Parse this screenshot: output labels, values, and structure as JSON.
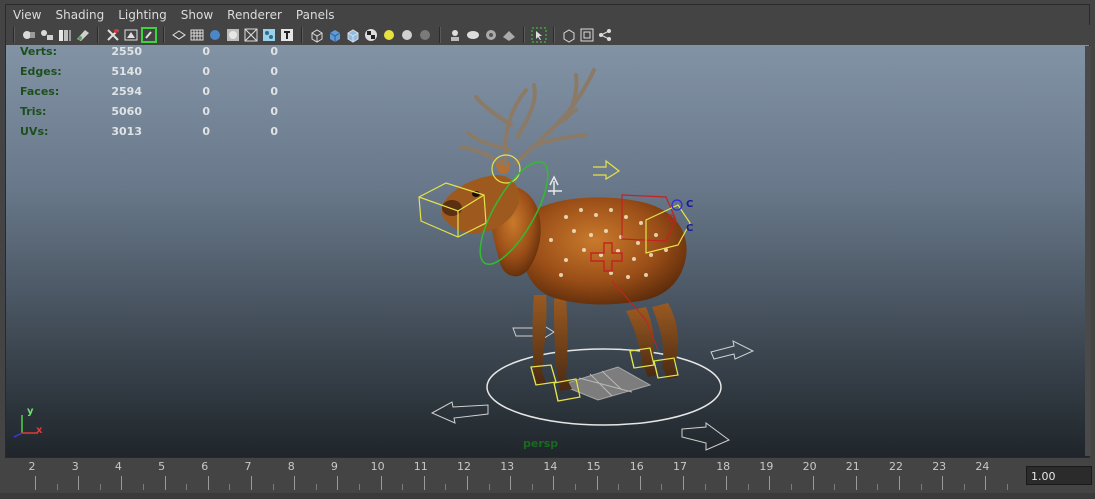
{
  "menu": [
    "View",
    "Shading",
    "Lighting",
    "Show",
    "Renderer",
    "Panels"
  ],
  "toolbar_icons": [
    "select-camera-icon",
    "camera-attributes-icon",
    "bookmark-icon",
    "image-plane-icon",
    "grid-toggle-icon",
    "resolution-gate-icon",
    "film-gate-icon",
    "wireframe-icon",
    "smooth-shade-icon",
    "shade-all-icon",
    "bounding-box-icon",
    "xray-icon",
    "texture-icon",
    "default-material-icon",
    "smooth-shade-selected-icon",
    "wireframe-on-shaded-icon",
    "checker-texture-icon",
    "lights-icon",
    "shadows-icon",
    "ambient-occlusion-icon",
    "isolate-select-icon",
    "xray-joints-icon",
    "xray-active-icon",
    "backface-icon",
    "select-tool-icon",
    "paint-select-icon",
    "frame-all-icon",
    "frame-selected-icon",
    "hierarchy-icon"
  ],
  "hud": [
    {
      "label": "Verts:",
      "values": [
        "2550",
        "0",
        "0"
      ]
    },
    {
      "label": "Edges:",
      "values": [
        "5140",
        "0",
        "0"
      ]
    },
    {
      "label": "Faces:",
      "values": [
        "2594",
        "0",
        "0"
      ]
    },
    {
      "label": "Tris:",
      "values": [
        "5060",
        "0",
        "0"
      ]
    },
    {
      "label": "UVs:",
      "values": [
        "3013",
        "0",
        "0"
      ]
    }
  ],
  "camera_label": "persp",
  "axis": {
    "y": "y",
    "x": "x"
  },
  "control_labels": [
    "C",
    "C"
  ],
  "timeline": {
    "frames": [
      "2",
      "3",
      "4",
      "5",
      "6",
      "7",
      "8",
      "9",
      "10",
      "11",
      "12",
      "13",
      "14",
      "15",
      "16",
      "17",
      "18",
      "19",
      "20",
      "21",
      "22",
      "23",
      "24"
    ],
    "current_frame": "1.00"
  },
  "colors": {
    "viewport_top": "#8293a5",
    "viewport_bottom": "#1f252a",
    "control_yellow": "#e6e24a",
    "control_red": "#c42222",
    "control_green": "#35b832",
    "hud_label": "#1d4f1d"
  }
}
